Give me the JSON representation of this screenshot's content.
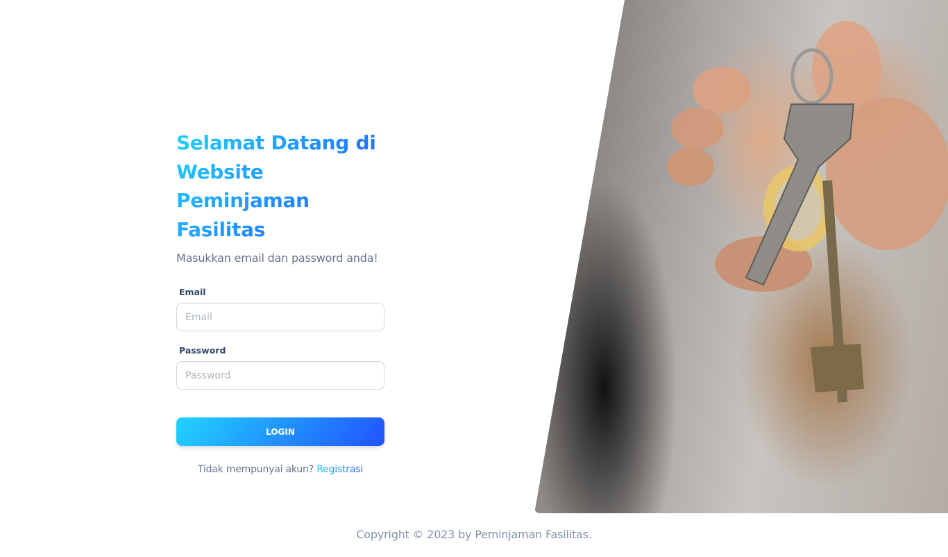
{
  "login": {
    "title": "Selamat Datang di Website Peminjaman Fasilitas",
    "subtitle": "Masukkan email dan password anda!",
    "email_label": "Email",
    "email_placeholder": "Email",
    "password_label": "Password",
    "password_placeholder": "Password",
    "login_button": "LOGIN",
    "no_account_text": "Tidak mempunyai akun?",
    "register_link": "Registrasi"
  },
  "footer": {
    "copyright": "Copyright © 2023 by Peminjaman Fasilitas."
  },
  "colors": {
    "gradient_start": "#21d4fd",
    "gradient_end": "#2152ff",
    "text_muted": "#67748e",
    "label": "#344767"
  },
  "illustration": {
    "icon": "hand-holding-keys-photo"
  }
}
